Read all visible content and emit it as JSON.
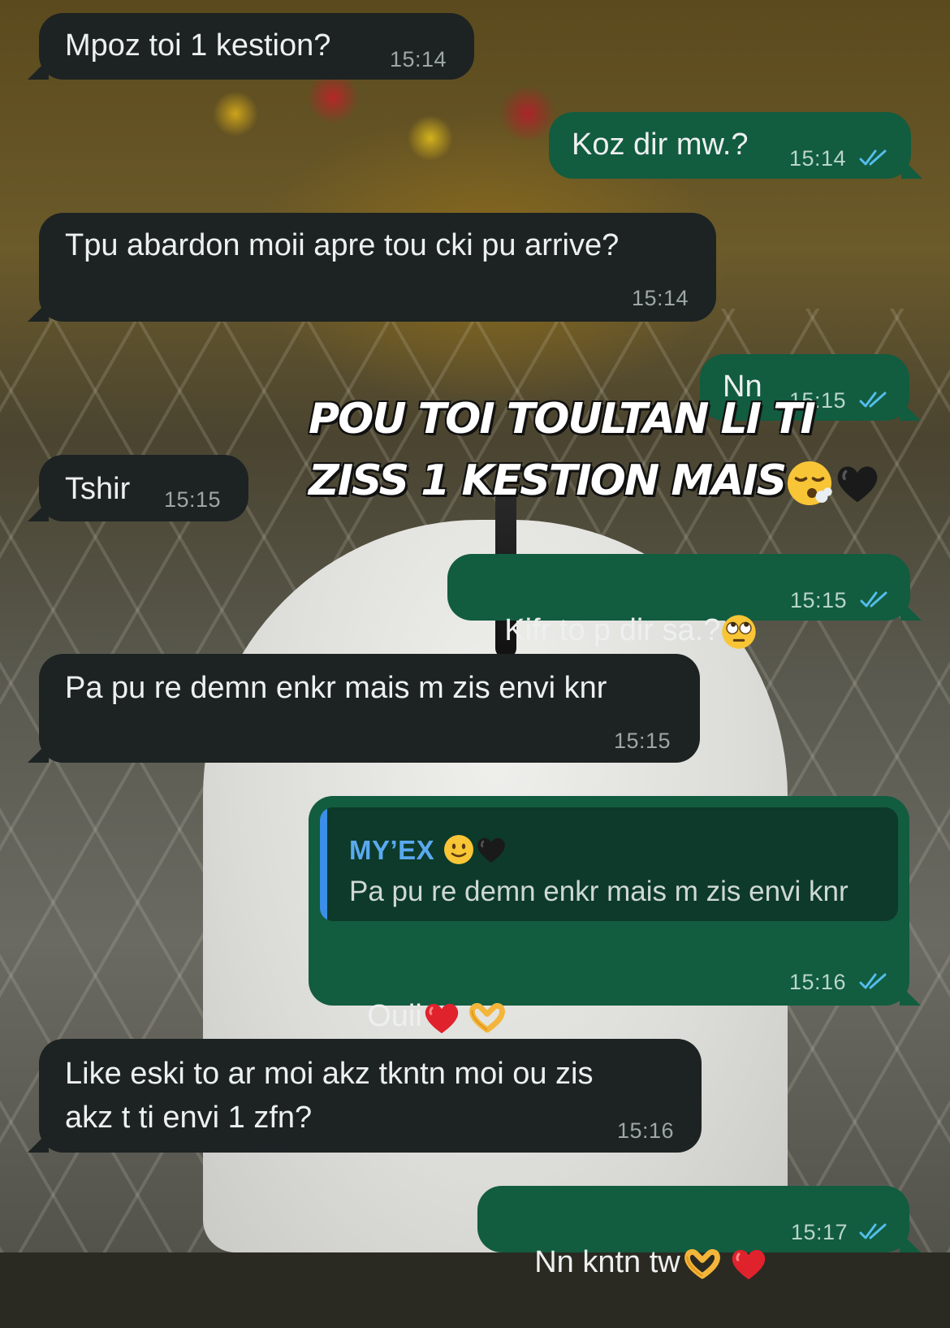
{
  "messages": [
    {
      "text": "Mpoz toi 1 kestion?",
      "time": "15:14"
    },
    {
      "text": "Koz dir mw.?",
      "time": "15:14"
    },
    {
      "text": "Tpu abardon moii apre tou cki pu arrive?",
      "time": "15:14"
    },
    {
      "text": "Nn",
      "time": "15:15"
    },
    {
      "text": "Tshir",
      "time": "15:15"
    },
    {
      "text": "Kifr to p dir sa.?",
      "time": "15:15"
    },
    {
      "text": "Pa pu re demn enkr mais m zis envi knr",
      "time": "15:15"
    },
    {
      "reply_author": "MY’EX",
      "reply_text": "Pa pu re demn enkr mais m zis envi knr",
      "text": "Ouii",
      "time": "15:16"
    },
    {
      "text": "Like eski to ar moi akz tkntn moi ou zis\nakz t ti envi 1 zfn?",
      "time": "15:16"
    },
    {
      "text": "Nn kntn tw",
      "time": "15:17"
    }
  ],
  "overlay": {
    "line1": "POU TOI TOULTAN LI TI",
    "line2": "ZISS  1 KESTION MAIS"
  },
  "colors": {
    "incoming_bubble": "#1d2323",
    "outgoing_bubble": "#125c40",
    "read_ticks": "#53bdeb",
    "reply_author": "#5aa9f0"
  },
  "icons": [
    "double-check-icon",
    "face-exhaling-emoji",
    "black-heart-emoji",
    "face-rolling-eyes-emoji",
    "slightly-smiling-face-emoji",
    "red-heart-emoji",
    "heart-hands-emoji"
  ]
}
